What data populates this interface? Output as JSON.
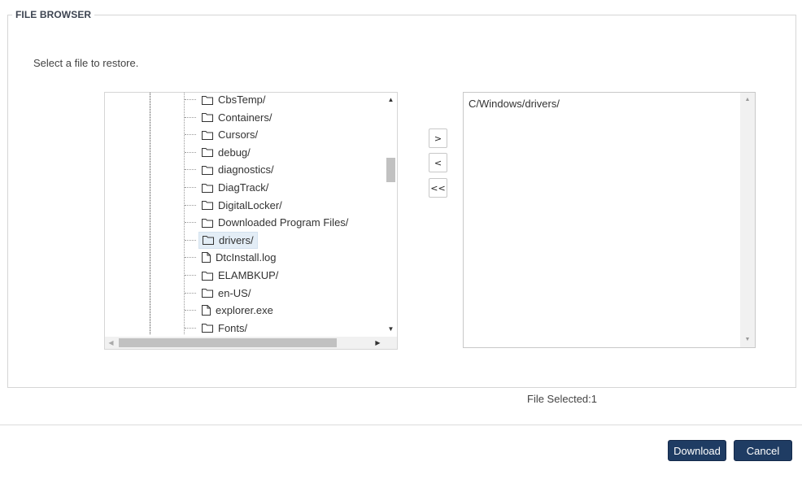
{
  "legend": "FILE BROWSER",
  "instruction": "Select a file to restore.",
  "tree": {
    "items": [
      {
        "label": "CbsTemp/",
        "type": "folder",
        "selected": false
      },
      {
        "label": "Containers/",
        "type": "folder",
        "selected": false
      },
      {
        "label": "Cursors/",
        "type": "folder",
        "selected": false
      },
      {
        "label": "debug/",
        "type": "folder",
        "selected": false
      },
      {
        "label": "diagnostics/",
        "type": "folder",
        "selected": false
      },
      {
        "label": "DiagTrack/",
        "type": "folder",
        "selected": false
      },
      {
        "label": "DigitalLocker/",
        "type": "folder",
        "selected": false
      },
      {
        "label": "Downloaded Program Files/",
        "type": "folder",
        "selected": false
      },
      {
        "label": "drivers/",
        "type": "folder",
        "selected": true
      },
      {
        "label": "DtcInstall.log",
        "type": "file",
        "selected": false
      },
      {
        "label": "ELAMBKUP/",
        "type": "folder",
        "selected": false
      },
      {
        "label": "en-US/",
        "type": "folder",
        "selected": false
      },
      {
        "label": "explorer.exe",
        "type": "file",
        "selected": false
      },
      {
        "label": "Fonts/",
        "type": "folder",
        "selected": false
      }
    ]
  },
  "transfer_buttons": {
    "add": ">",
    "remove": "<",
    "remove_all": "<<"
  },
  "selected_list": {
    "items": [
      "C/Windows/drivers/"
    ]
  },
  "file_count": "File Selected:1",
  "buttons": {
    "download": "Download",
    "cancel": "Cancel"
  },
  "colors": {
    "primary_button": "#1f3c63",
    "selection_bg": "#e3edf6"
  }
}
